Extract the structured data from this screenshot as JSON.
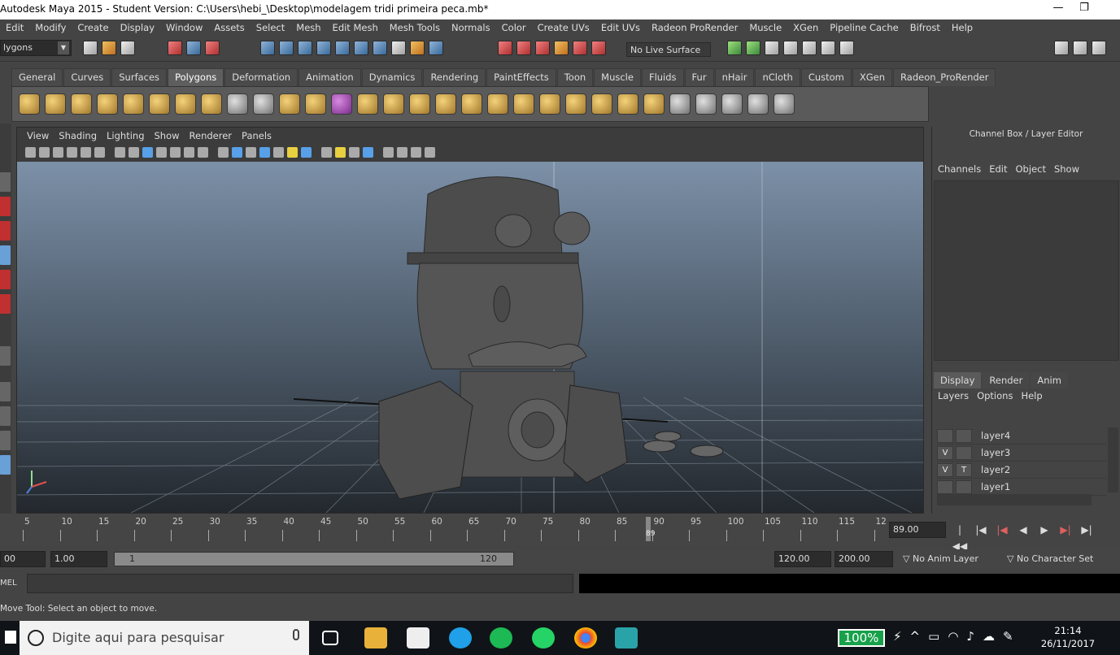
{
  "window": {
    "title": "Autodesk Maya 2015 - Student Version: C:\\Users\\hebi_\\Desktop\\modelagem tridi primeira peca.mb*",
    "minimize": "—",
    "maximize": "❐"
  },
  "menubar": [
    "Edit",
    "Modify",
    "Create",
    "Display",
    "Window",
    "Assets",
    "Select",
    "Mesh",
    "Edit Mesh",
    "Mesh Tools",
    "Normals",
    "Color",
    "Create UVs",
    "Edit UVs",
    "Radeon ProRender",
    "Muscle",
    "XGen",
    "Pipeline Cache",
    "Bifrost",
    "Help"
  ],
  "statusline": {
    "mode": "lygons",
    "live_surface": "No Live Surface"
  },
  "shelf": {
    "tabs": [
      "General",
      "Curves",
      "Surfaces",
      "Polygons",
      "Deformation",
      "Animation",
      "Dynamics",
      "Rendering",
      "PaintEffects",
      "Toon",
      "Muscle",
      "Fluids",
      "Fur",
      "nHair",
      "nCloth",
      "Custom",
      "XGen",
      "Radeon_ProRender"
    ],
    "active_tab": "Polygons"
  },
  "panel": {
    "menu": [
      "View",
      "Shading",
      "Lighting",
      "Show",
      "Renderer",
      "Panels"
    ]
  },
  "channelbox": {
    "title": "Channel Box / Layer Editor",
    "menu": [
      "Channels",
      "Edit",
      "Object",
      "Show"
    ],
    "layer_tabs": [
      "Display",
      "Render",
      "Anim"
    ],
    "active_layer_tab": "Display",
    "layer_menu": [
      "Layers",
      "Options",
      "Help"
    ],
    "layers": [
      {
        "name": "layer4",
        "v": "",
        "t": ""
      },
      {
        "name": "layer3",
        "v": "V",
        "t": ""
      },
      {
        "name": "layer2",
        "v": "V",
        "t": "T"
      },
      {
        "name": "layer1",
        "v": "",
        "t": ""
      }
    ]
  },
  "timeslider": {
    "ticks": [
      "5",
      "10",
      "15",
      "20",
      "25",
      "30",
      "35",
      "40",
      "45",
      "50",
      "55",
      "60",
      "65",
      "70",
      "75",
      "80",
      "85",
      "90",
      "95",
      "100",
      "105",
      "110",
      "115",
      "12"
    ],
    "current_frame": "89",
    "current_time": "89.00"
  },
  "range": {
    "start_field": "00",
    "playback_start": "1.00",
    "range_start": "1",
    "range_end": "120",
    "playback_end": "120.00",
    "end_field": "200.00",
    "anim_layer": "No Anim Layer",
    "character_set": "No Character Set"
  },
  "cmdline": {
    "label": "MEL"
  },
  "helpline": {
    "text": "Move Tool: Select an object to move."
  },
  "taskbar": {
    "search_placeholder": "Digite aqui para pesquisar",
    "battery": "100%",
    "time": "21:14",
    "date": "26/11/2017",
    "colors": {
      "bg": "#101418",
      "battery": "#17a14a"
    }
  }
}
